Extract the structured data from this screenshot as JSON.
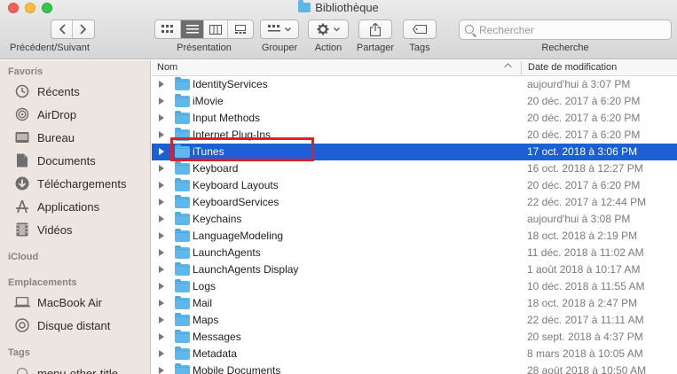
{
  "window": {
    "title": "Bibliothèque"
  },
  "toolbar": {
    "nav_label": "Précédent/Suivant",
    "view_label": "Présentation",
    "group_label": "Grouper",
    "action_label": "Action",
    "share_label": "Partager",
    "tags_label": "Tags",
    "search_label": "Recherche",
    "search_placeholder": "Rechercher"
  },
  "sidebar": {
    "favorites_heading": "Favoris",
    "favorites": [
      {
        "label": "Récents",
        "icon": "clock-icon"
      },
      {
        "label": "AirDrop",
        "icon": "airdrop-icon"
      },
      {
        "label": "Bureau",
        "icon": "desktop-icon"
      },
      {
        "label": "Documents",
        "icon": "document-icon"
      },
      {
        "label": "Téléchargements",
        "icon": "download-icon"
      },
      {
        "label": "Applications",
        "icon": "applications-icon"
      },
      {
        "label": "Vidéos",
        "icon": "film-icon"
      }
    ],
    "icloud_heading": "iCloud",
    "locations_heading": "Emplacements",
    "locations": [
      {
        "label": "MacBook Air",
        "icon": "laptop-icon"
      },
      {
        "label": "Disque distant",
        "icon": "disc-icon"
      }
    ],
    "tags_heading": "Tags",
    "tags": [
      {
        "label": "menu-other-title"
      }
    ]
  },
  "columns": {
    "name": "Nom",
    "date": "Date de modification"
  },
  "files": [
    {
      "name": "IdentityServices",
      "date": "aujourd'hui à 3:07 PM"
    },
    {
      "name": "iMovie",
      "date": "20 déc. 2017 à 6:20 PM"
    },
    {
      "name": "Input Methods",
      "date": "20 déc. 2017 à 6:20 PM"
    },
    {
      "name": "Internet Plug-Ins",
      "date": "20 déc. 2017 à 6:20 PM"
    },
    {
      "name": "iTunes",
      "date": "17 oct. 2018 à 3:06 PM"
    },
    {
      "name": "Keyboard",
      "date": "16 oct. 2018 à 12:27 PM"
    },
    {
      "name": "Keyboard Layouts",
      "date": "20 déc. 2017 à 6:20 PM"
    },
    {
      "name": "KeyboardServices",
      "date": "22 déc. 2017 à 12:44 PM"
    },
    {
      "name": "Keychains",
      "date": "aujourd'hui à 3:08 PM"
    },
    {
      "name": "LanguageModeling",
      "date": "18 oct. 2018 à 2:19 PM"
    },
    {
      "name": "LaunchAgents",
      "date": "11 déc. 2018 à 11:02 AM"
    },
    {
      "name": "LaunchAgents Display",
      "date": "1 août 2018 à 10:17 AM"
    },
    {
      "name": "Logs",
      "date": "10 déc. 2018 à 11:55 AM"
    },
    {
      "name": "Mail",
      "date": "18 oct. 2018 à 2:47 PM"
    },
    {
      "name": "Maps",
      "date": "22 déc. 2017 à 11:11 AM"
    },
    {
      "name": "Messages",
      "date": "20 sept. 2018 à 4:37 PM"
    },
    {
      "name": "Metadata",
      "date": "8 mars 2018 à 10:05 AM"
    },
    {
      "name": "Mobile Documents",
      "date": "28 août 2018 à 10:50 AM"
    }
  ],
  "selected_index": 4,
  "colors": {
    "selection": "#1d5ed6",
    "highlight": "#e02020",
    "folder": "#5eb8ec"
  }
}
